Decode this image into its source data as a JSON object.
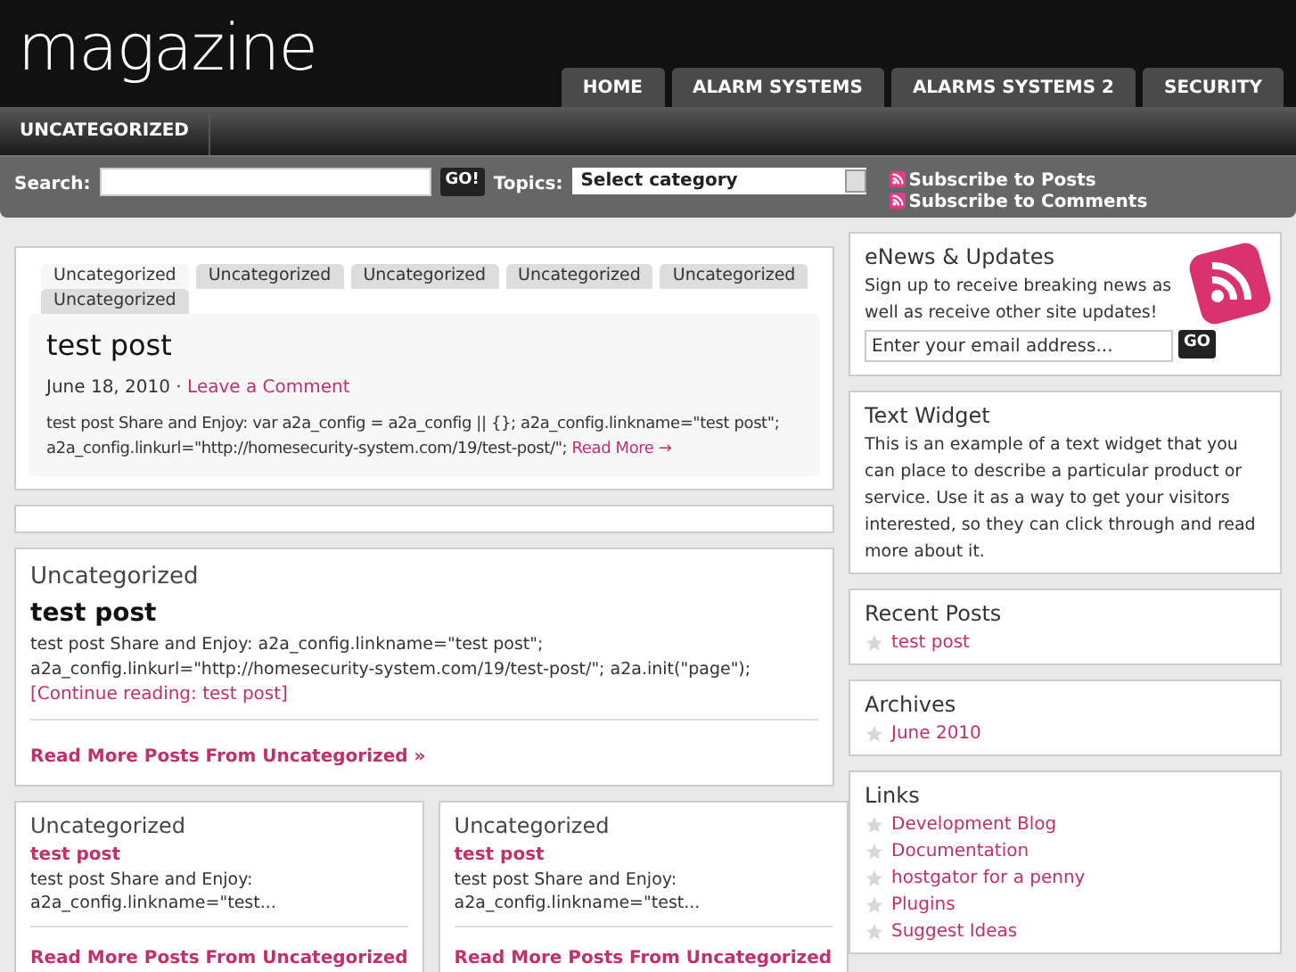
{
  "logo": "magazine",
  "nav": [
    {
      "label": "HOME",
      "selected": false
    },
    {
      "label": "ALARM SYSTEMS",
      "selected": false
    },
    {
      "label": "ALARMS SYSTEMS 2",
      "selected": false
    },
    {
      "label": "SECURITY",
      "selected": false
    }
  ],
  "subnav": [
    {
      "label": "UNCATEGORIZED"
    }
  ],
  "searchbar": {
    "label": "Search:",
    "button": "GO!",
    "topics_label": "Topics:",
    "topics_value": "Select category",
    "subscribe_posts": "Subscribe to Posts",
    "subscribe_comments": "Subscribe to Comments"
  },
  "featured": {
    "tabs": [
      {
        "label": "Uncategorized",
        "selected": true
      },
      {
        "label": "Uncategorized",
        "selected": false
      },
      {
        "label": "Uncategorized",
        "selected": false
      },
      {
        "label": "Uncategorized",
        "selected": false
      },
      {
        "label": "Uncategorized",
        "selected": false
      },
      {
        "label": "Uncategorized",
        "selected": false
      }
    ],
    "title": "test post",
    "date": "June 18, 2010 ·",
    "comment_link": "Leave a Comment",
    "excerpt": "test post Share and Enjoy: var a2a_config = a2a_config || {}; a2a_config.linkname=\"test post\"; a2a_config.linkurl=\"http://homesecurity-system.com/19/test-post/\";",
    "read_more": "Read More →"
  },
  "category_box": {
    "category": "Uncategorized",
    "title": "test post",
    "excerpt": "test post Share and Enjoy: a2a_config.linkname=\"test post\"; a2a_config.linkurl=\"http://homesecurity-system.com/19/test-post/\"; a2a.init(\"page\");",
    "continue": "[Continue reading: test post]",
    "more": "Read More Posts From Uncategorized »"
  },
  "small_boxes": [
    {
      "category": "Uncategorized",
      "title": "test post",
      "excerpt": "test post Share and Enjoy: a2a_config.linkname=\"test...",
      "more": "Read More Posts From Uncategorized"
    },
    {
      "category": "Uncategorized",
      "title": "test post",
      "excerpt": "test post Share and Enjoy: a2a_config.linkname=\"test...",
      "more": "Read More Posts From Uncategorized"
    }
  ],
  "enews": {
    "title": "eNews & Updates",
    "text": "Sign up to receive breaking news as well as receive other site updates!",
    "placeholder": "Enter your email address...",
    "button": "GO"
  },
  "text_widget": {
    "title": "Text Widget",
    "text": "This is an example of a text widget that you can place to describe a particular product or service. Use it as a way to get your visitors interested, so they can click through and read more about it."
  },
  "lists": [
    {
      "title": "Recent Posts",
      "items": [
        "test post"
      ]
    },
    {
      "title": "Archives",
      "items": [
        "June 2010"
      ]
    },
    {
      "title": "Links",
      "items": [
        "Development Blog",
        "Documentation",
        "hostgator for a penny",
        "Plugins",
        "Suggest Ideas"
      ]
    }
  ]
}
